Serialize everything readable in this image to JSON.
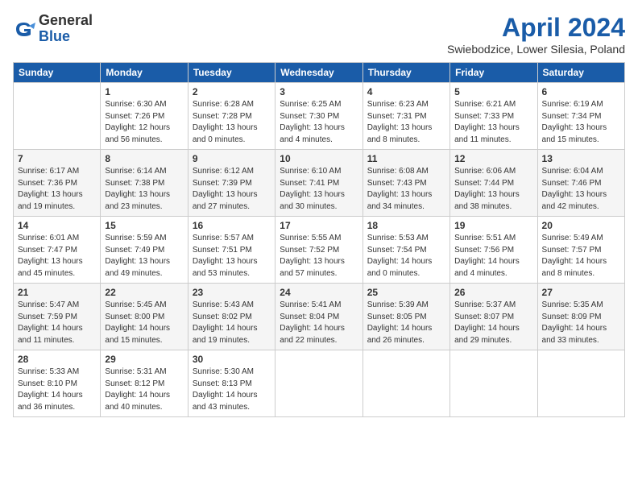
{
  "logo": {
    "general": "General",
    "blue": "Blue"
  },
  "title": "April 2024",
  "subtitle": "Swiebodzice, Lower Silesia, Poland",
  "weekdays": [
    "Sunday",
    "Monday",
    "Tuesday",
    "Wednesday",
    "Thursday",
    "Friday",
    "Saturday"
  ],
  "weeks": [
    [
      {
        "day": "",
        "info": ""
      },
      {
        "day": "1",
        "info": "Sunrise: 6:30 AM\nSunset: 7:26 PM\nDaylight: 12 hours\nand 56 minutes."
      },
      {
        "day": "2",
        "info": "Sunrise: 6:28 AM\nSunset: 7:28 PM\nDaylight: 13 hours\nand 0 minutes."
      },
      {
        "day": "3",
        "info": "Sunrise: 6:25 AM\nSunset: 7:30 PM\nDaylight: 13 hours\nand 4 minutes."
      },
      {
        "day": "4",
        "info": "Sunrise: 6:23 AM\nSunset: 7:31 PM\nDaylight: 13 hours\nand 8 minutes."
      },
      {
        "day": "5",
        "info": "Sunrise: 6:21 AM\nSunset: 7:33 PM\nDaylight: 13 hours\nand 11 minutes."
      },
      {
        "day": "6",
        "info": "Sunrise: 6:19 AM\nSunset: 7:34 PM\nDaylight: 13 hours\nand 15 minutes."
      }
    ],
    [
      {
        "day": "7",
        "info": "Sunrise: 6:17 AM\nSunset: 7:36 PM\nDaylight: 13 hours\nand 19 minutes."
      },
      {
        "day": "8",
        "info": "Sunrise: 6:14 AM\nSunset: 7:38 PM\nDaylight: 13 hours\nand 23 minutes."
      },
      {
        "day": "9",
        "info": "Sunrise: 6:12 AM\nSunset: 7:39 PM\nDaylight: 13 hours\nand 27 minutes."
      },
      {
        "day": "10",
        "info": "Sunrise: 6:10 AM\nSunset: 7:41 PM\nDaylight: 13 hours\nand 30 minutes."
      },
      {
        "day": "11",
        "info": "Sunrise: 6:08 AM\nSunset: 7:43 PM\nDaylight: 13 hours\nand 34 minutes."
      },
      {
        "day": "12",
        "info": "Sunrise: 6:06 AM\nSunset: 7:44 PM\nDaylight: 13 hours\nand 38 minutes."
      },
      {
        "day": "13",
        "info": "Sunrise: 6:04 AM\nSunset: 7:46 PM\nDaylight: 13 hours\nand 42 minutes."
      }
    ],
    [
      {
        "day": "14",
        "info": "Sunrise: 6:01 AM\nSunset: 7:47 PM\nDaylight: 13 hours\nand 45 minutes."
      },
      {
        "day": "15",
        "info": "Sunrise: 5:59 AM\nSunset: 7:49 PM\nDaylight: 13 hours\nand 49 minutes."
      },
      {
        "day": "16",
        "info": "Sunrise: 5:57 AM\nSunset: 7:51 PM\nDaylight: 13 hours\nand 53 minutes."
      },
      {
        "day": "17",
        "info": "Sunrise: 5:55 AM\nSunset: 7:52 PM\nDaylight: 13 hours\nand 57 minutes."
      },
      {
        "day": "18",
        "info": "Sunrise: 5:53 AM\nSunset: 7:54 PM\nDaylight: 14 hours\nand 0 minutes."
      },
      {
        "day": "19",
        "info": "Sunrise: 5:51 AM\nSunset: 7:56 PM\nDaylight: 14 hours\nand 4 minutes."
      },
      {
        "day": "20",
        "info": "Sunrise: 5:49 AM\nSunset: 7:57 PM\nDaylight: 14 hours\nand 8 minutes."
      }
    ],
    [
      {
        "day": "21",
        "info": "Sunrise: 5:47 AM\nSunset: 7:59 PM\nDaylight: 14 hours\nand 11 minutes."
      },
      {
        "day": "22",
        "info": "Sunrise: 5:45 AM\nSunset: 8:00 PM\nDaylight: 14 hours\nand 15 minutes."
      },
      {
        "day": "23",
        "info": "Sunrise: 5:43 AM\nSunset: 8:02 PM\nDaylight: 14 hours\nand 19 minutes."
      },
      {
        "day": "24",
        "info": "Sunrise: 5:41 AM\nSunset: 8:04 PM\nDaylight: 14 hours\nand 22 minutes."
      },
      {
        "day": "25",
        "info": "Sunrise: 5:39 AM\nSunset: 8:05 PM\nDaylight: 14 hours\nand 26 minutes."
      },
      {
        "day": "26",
        "info": "Sunrise: 5:37 AM\nSunset: 8:07 PM\nDaylight: 14 hours\nand 29 minutes."
      },
      {
        "day": "27",
        "info": "Sunrise: 5:35 AM\nSunset: 8:09 PM\nDaylight: 14 hours\nand 33 minutes."
      }
    ],
    [
      {
        "day": "28",
        "info": "Sunrise: 5:33 AM\nSunset: 8:10 PM\nDaylight: 14 hours\nand 36 minutes."
      },
      {
        "day": "29",
        "info": "Sunrise: 5:31 AM\nSunset: 8:12 PM\nDaylight: 14 hours\nand 40 minutes."
      },
      {
        "day": "30",
        "info": "Sunrise: 5:30 AM\nSunset: 8:13 PM\nDaylight: 14 hours\nand 43 minutes."
      },
      {
        "day": "",
        "info": ""
      },
      {
        "day": "",
        "info": ""
      },
      {
        "day": "",
        "info": ""
      },
      {
        "day": "",
        "info": ""
      }
    ]
  ]
}
